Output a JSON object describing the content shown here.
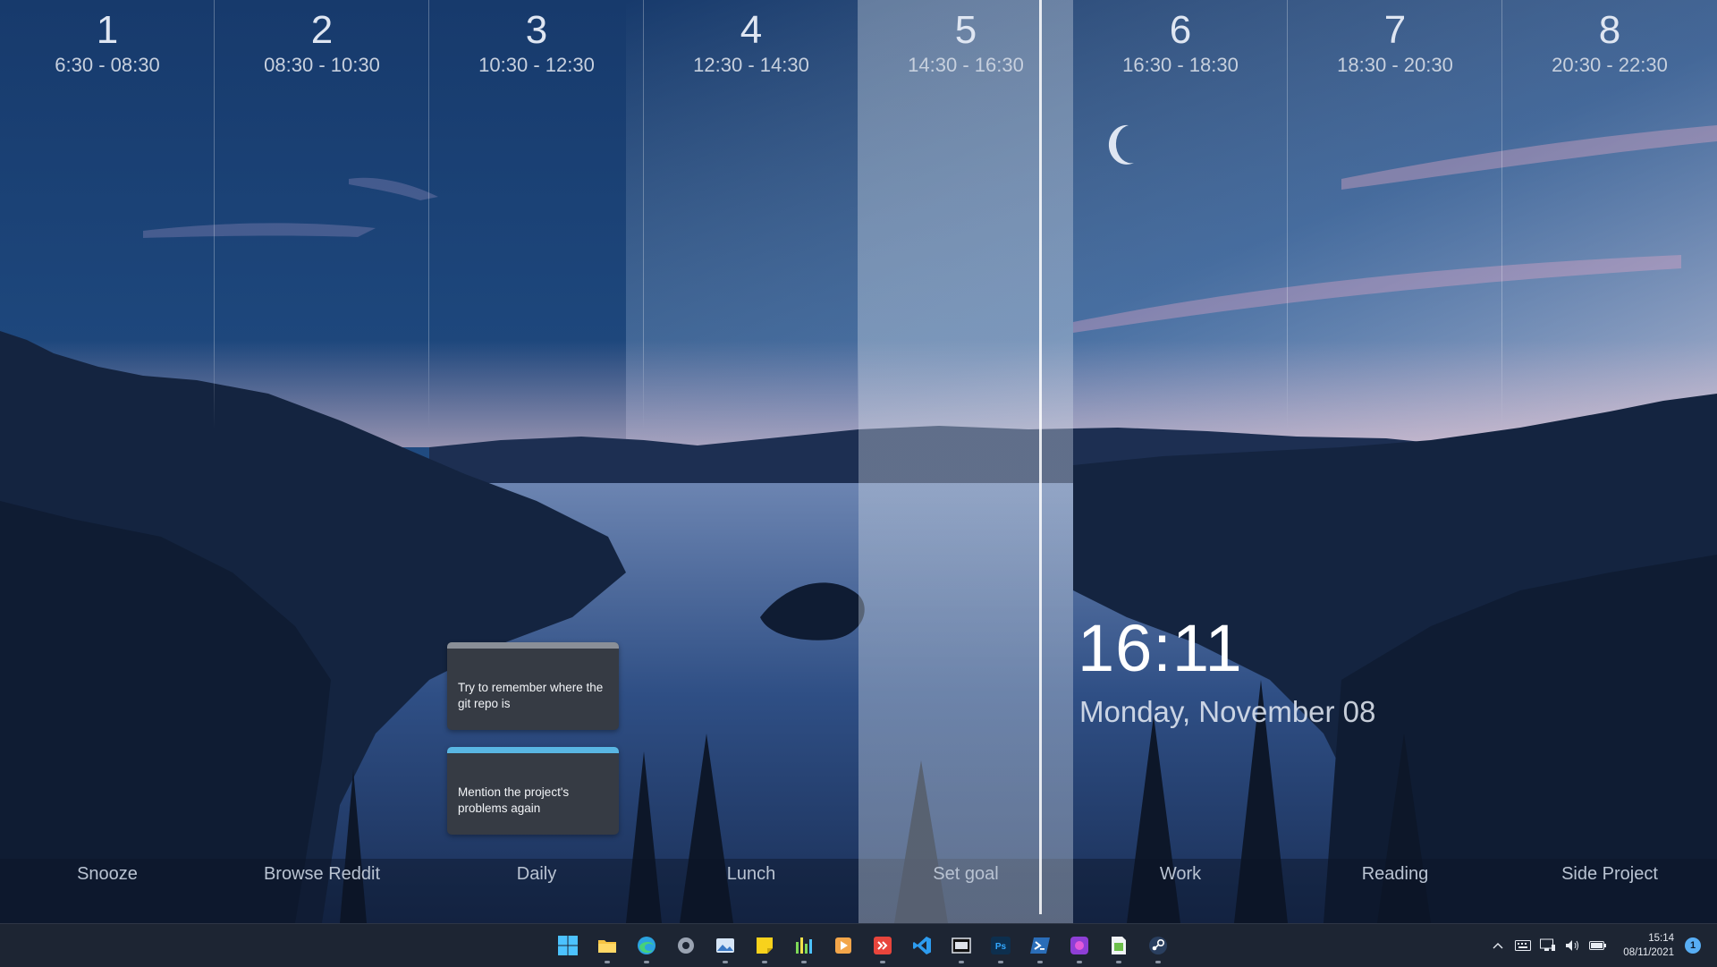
{
  "slots": [
    {
      "number": "1",
      "time": "6:30  - 08:30",
      "task": "Snooze"
    },
    {
      "number": "2",
      "time": "08:30 - 10:30",
      "task": "Browse Reddit"
    },
    {
      "number": "3",
      "time": "10:30 - 12:30",
      "task": "Daily"
    },
    {
      "number": "4",
      "time": "12:30 - 14:30",
      "task": "Lunch"
    },
    {
      "number": "5",
      "time": "14:30 - 16:30",
      "task": "Set goal"
    },
    {
      "number": "6",
      "time": "16:30 - 18:30",
      "task": "Work"
    },
    {
      "number": "7",
      "time": "18:30 - 20:30",
      "task": "Reading"
    },
    {
      "number": "8",
      "time": "20:30 - 22:30",
      "task": "Side Project"
    }
  ],
  "active_slot": 5,
  "notes": [
    {
      "text": "Try to remember where the git repo is",
      "accent": "#8a8f97"
    },
    {
      "text": "Mention the project's problems again",
      "accent": "#59b6e3"
    }
  ],
  "lock": {
    "time": "16:11",
    "date": "Monday, November 08"
  },
  "taskbar": {
    "apps": [
      {
        "name": "start-icon"
      },
      {
        "name": "file-explorer-icon",
        "running": true
      },
      {
        "name": "edge-browser-icon",
        "running": true
      },
      {
        "name": "settings-gear-icon"
      },
      {
        "name": "photos-icon",
        "running": true
      },
      {
        "name": "sticky-notes-icon",
        "running": true
      },
      {
        "name": "equalizer-app-icon",
        "running": true
      },
      {
        "name": "media-player-icon"
      },
      {
        "name": "git-client-icon",
        "running": true
      },
      {
        "name": "vscode-icon"
      },
      {
        "name": "film-editor-icon",
        "running": true
      },
      {
        "name": "photoshop-icon",
        "running": true
      },
      {
        "name": "powershell-icon",
        "running": true
      },
      {
        "name": "purple-app-icon",
        "running": true
      },
      {
        "name": "spreadsheet-icon",
        "running": true
      },
      {
        "name": "steam-icon",
        "running": true
      }
    ],
    "photoshop_label": "Ps",
    "tray": {
      "time": "15:14",
      "date": "08/11/2021",
      "notifications": "1"
    }
  },
  "colors": {
    "accent": "#58aef5",
    "taskbar": "#1d2533"
  }
}
